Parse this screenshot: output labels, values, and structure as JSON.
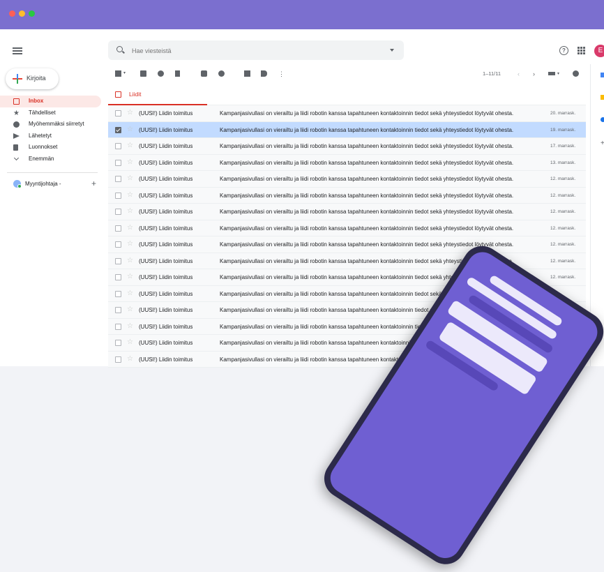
{
  "search": {
    "placeholder": "Hae viesteistä"
  },
  "header": {
    "avatar_initial": "E",
    "help_label": "?"
  },
  "compose": {
    "label": "Kirjoita"
  },
  "sidebar": {
    "items": [
      {
        "label": "Inbox",
        "icon": "inbox-icon"
      },
      {
        "label": "Tähdelliset",
        "icon": "star-icon"
      },
      {
        "label": "Myöhemmäksi siirretyt",
        "icon": "clock-icon"
      },
      {
        "label": "Lähetetyt",
        "icon": "send-icon"
      },
      {
        "label": "Luonnokset",
        "icon": "draft-icon"
      },
      {
        "label": "Enemmän",
        "icon": "chevron-down-icon"
      }
    ],
    "user": {
      "name": "Myyntijohtaja -",
      "add": "+"
    }
  },
  "toolbar": {
    "pager": "1–11/11"
  },
  "tab": {
    "label": "Liidit"
  },
  "emails": [
    {
      "sender": "(UUSI!) Liidin toimitus",
      "subject": "Kampanjasivullasi on vierailtu ja liidi robotin kanssa tapahtuneen kontaktoinnin tiedot sekä yhteystiedot löytyvät ohesta.",
      "date": "20. marrask.",
      "selected": false
    },
    {
      "sender": "(UUSI!) Liidin toimitus",
      "subject": "Kampanjasivullasi on vierailtu ja liidi robotin kanssa tapahtuneen kontaktoinnin tiedot sekä yhteystiedot löytyvät ohesta.",
      "date": "19. marrask.",
      "selected": true
    },
    {
      "sender": "(UUSI!) Liidin toimitus",
      "subject": "Kampanjasivullasi on vierailtu ja liidi robotin kanssa tapahtuneen kontaktoinnin tiedot sekä yhteystiedot löytyvät ohesta.",
      "date": "17. marrask.",
      "selected": false
    },
    {
      "sender": "(UUSI!) Liidin toimitus",
      "subject": "Kampanjasivullasi on vierailtu ja liidi robotin kanssa tapahtuneen kontaktoinnin tiedot sekä yhteystiedot löytyvät ohesta.",
      "date": "13. marrask.",
      "selected": false
    },
    {
      "sender": "(UUSI!) Liidin toimitus",
      "subject": "Kampanjasivullasi on vierailtu ja liidi robotin kanssa tapahtuneen kontaktoinnin tiedot sekä yhteystiedot löytyvät ohesta.",
      "date": "12. marrask.",
      "selected": false
    },
    {
      "sender": "(UUSI!) Liidin toimitus",
      "subject": "Kampanjasivullasi on vierailtu ja liidi robotin kanssa tapahtuneen kontaktoinnin tiedot sekä yhteystiedot löytyvät ohesta.",
      "date": "12. marrask.",
      "selected": false
    },
    {
      "sender": "(UUSI!) Liidin toimitus",
      "subject": "Kampanjasivullasi on vierailtu ja liidi robotin kanssa tapahtuneen kontaktoinnin tiedot sekä yhteystiedot löytyvät ohesta.",
      "date": "12. marrask.",
      "selected": false
    },
    {
      "sender": "(UUSI!) Liidin toimitus",
      "subject": "Kampanjasivullasi on vierailtu ja liidi robotin kanssa tapahtuneen kontaktoinnin tiedot sekä yhteystiedot löytyvät ohesta.",
      "date": "12. marrask.",
      "selected": false
    },
    {
      "sender": "(UUSI!) Liidin toimitus",
      "subject": "Kampanjasivullasi on vierailtu ja liidi robotin kanssa tapahtuneen kontaktoinnin tiedot sekä yhteystiedot löytyvät ohesta.",
      "date": "12. marrask.",
      "selected": false
    },
    {
      "sender": "(UUSI!) Liidin toimitus",
      "subject": "Kampanjasivullasi on vierailtu ja liidi robotin kanssa tapahtuneen kontaktoinnin tiedot sekä yhteystiedot löytyvät ohesta.",
      "date": "12. marrask.",
      "selected": false
    },
    {
      "sender": "(UUSI!) Liidin toimitus",
      "subject": "Kampanjasivullasi on vierailtu ja liidi robotin kanssa tapahtuneen kontaktoinnin tiedot sekä yhteystiedot löytyvät ohesta.",
      "date": "12. marrask.",
      "selected": false
    },
    {
      "sender": "(UUSI!) Liidin toimitus",
      "subject": "Kampanjasivullasi on vierailtu ja liidi robotin kanssa tapahtuneen kontaktoinnin tiedot sekä yhteystiedot löytyvät ohesta.",
      "date": "",
      "selected": false
    },
    {
      "sender": "(UUSI!) Liidin toimitus",
      "subject": "Kampanjasivullasi on vierailtu ja liidi robotin kanssa tapahtuneen kontaktoinnin tiedot sekä yhteystiedot löytyvät ohesta.",
      "date": "",
      "selected": false
    },
    {
      "sender": "(UUSI!) Liidin toimitus",
      "subject": "Kampanjasivullasi on vierailtu ja liidi robotin kanssa tapahtuneen kontaktoinnin tiedot sekä yhteystiedot löytyvät ohesta.",
      "date": "",
      "selected": false
    },
    {
      "sender": "(UUSI!) Liidin toimitus",
      "subject": "Kampanjasivullasi on vierailtu ja liidi robotin kanssa tapahtuneen kontaktoinnin tiedot sekä yhteystiedot löytyvät ohesta.",
      "date": "",
      "selected": false
    },
    {
      "sender": "(UUSI!) Liidin toimitus",
      "subject": "Kampanjasivullasi on vierailtu ja liidi robotin kanssa tapahtuneen kontaktoinnin tiedot sekä yhteystiedot löytyvät ohesta.",
      "date": "",
      "selected": false
    }
  ],
  "colors": {
    "titlebar": "#7b6fcf",
    "accent": "#d93025",
    "selected_row": "#c2dbff",
    "avatar": "#d93a6a",
    "phone_screen": "#6f5fd2"
  }
}
